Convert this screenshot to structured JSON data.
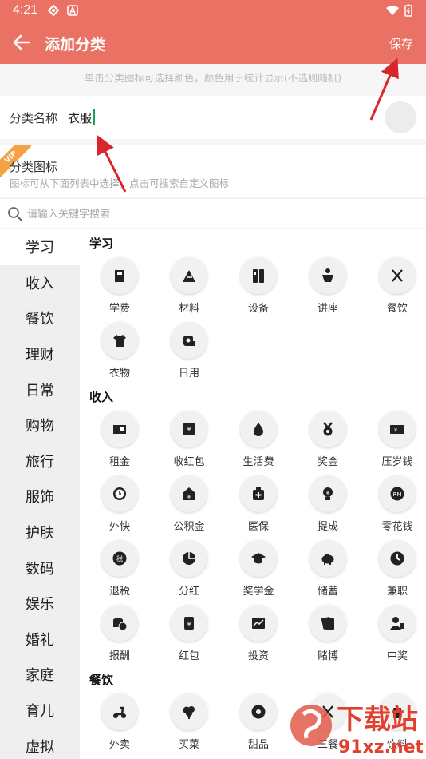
{
  "status": {
    "time": "4:21"
  },
  "appbar": {
    "title": "添加分类",
    "save_label": "保存"
  },
  "hint": "单击分类图标可选择颜色，颜色用于统计显示(不选则随机)",
  "name_field": {
    "label": "分类名称",
    "value": "衣服"
  },
  "icon_field": {
    "badge": "VIP",
    "label": "分类图标",
    "sub": "图标可从下面列表中选择，点击可搜索自定义图标"
  },
  "search": {
    "placeholder": "请输入关键字搜索"
  },
  "sidebar": [
    "学习",
    "收入",
    "餐饮",
    "理财",
    "日常",
    "购物",
    "旅行",
    "服饰",
    "护肤",
    "数码",
    "娱乐",
    "婚礼",
    "家庭",
    "育儿",
    "虚拟"
  ],
  "sections": [
    {
      "title": "学习",
      "items": [
        {
          "label": "学费",
          "icon": "book-icon"
        },
        {
          "label": "材料",
          "icon": "triangle-ruler-icon"
        },
        {
          "label": "设备",
          "icon": "device-icon"
        },
        {
          "label": "讲座",
          "icon": "podium-icon"
        },
        {
          "label": "餐饮",
          "icon": "fork-knife-icon"
        },
        {
          "label": "衣物",
          "icon": "tshirt-icon"
        },
        {
          "label": "日用",
          "icon": "toilet-paper-icon"
        }
      ]
    },
    {
      "title": "收入",
      "items": [
        {
          "label": "租金",
          "icon": "rent-icon"
        },
        {
          "label": "收红包",
          "icon": "red-envelope-icon"
        },
        {
          "label": "生活费",
          "icon": "drop-icon"
        },
        {
          "label": "奖金",
          "icon": "medal-icon"
        },
        {
          "label": "压岁钱",
          "icon": "wallet-icon"
        },
        {
          "label": "外快",
          "icon": "clock-coin-icon"
        },
        {
          "label": "公积金",
          "icon": "house-yen-icon"
        },
        {
          "label": "医保",
          "icon": "medical-icon"
        },
        {
          "label": "提成",
          "icon": "bulb-yen-icon"
        },
        {
          "label": "零花钱",
          "icon": "rm-coin-icon"
        },
        {
          "label": "退税",
          "icon": "tax-icon"
        },
        {
          "label": "分红",
          "icon": "pie-icon"
        },
        {
          "label": "奖学金",
          "icon": "grad-cap-icon"
        },
        {
          "label": "储蓄",
          "icon": "piggy-icon"
        },
        {
          "label": "兼职",
          "icon": "clock-icon"
        },
        {
          "label": "报酬",
          "icon": "coins-icon"
        },
        {
          "label": "红包",
          "icon": "envelope-yen-icon"
        },
        {
          "label": "投资",
          "icon": "chart-icon"
        },
        {
          "label": "赌博",
          "icon": "cards-icon"
        },
        {
          "label": "中奖",
          "icon": "winner-icon"
        }
      ]
    },
    {
      "title": "餐饮",
      "items": [
        {
          "label": "外卖",
          "icon": "scooter-icon"
        },
        {
          "label": "买菜",
          "icon": "vegetable-icon"
        },
        {
          "label": "甜品",
          "icon": "donut-icon"
        },
        {
          "label": "三餐",
          "icon": "meal-icon"
        },
        {
          "label": "饮料",
          "icon": "drink-icon"
        }
      ]
    }
  ],
  "colors": {
    "accent": "#ea7264",
    "arrow": "#d8262c"
  }
}
